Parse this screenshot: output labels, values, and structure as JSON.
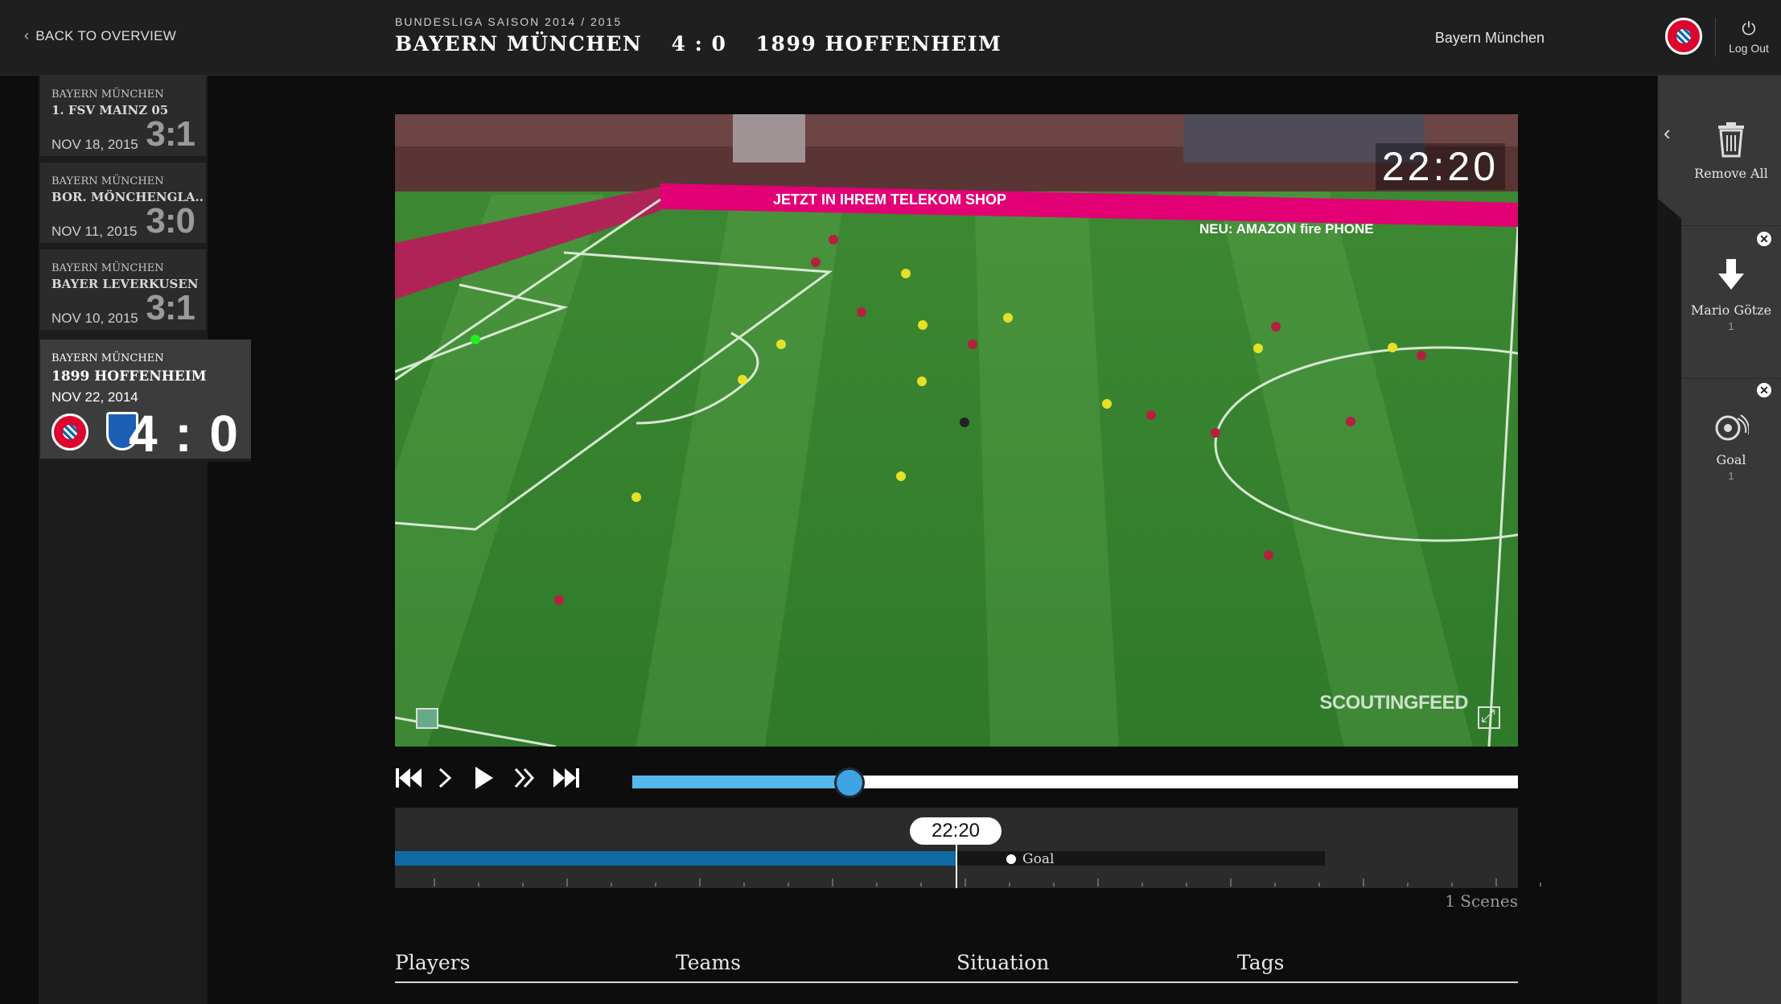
{
  "header": {
    "back_label": "BACK TO OVERVIEW",
    "season": "BUNDESLIGA SAISON 2014 / 2015",
    "home_team": "BAYERN MÜNCHEN",
    "score": "4 : 0",
    "away_team": "1899 HOFFENHEIM",
    "user_team": "Bayern München",
    "logout_label": "Log Out"
  },
  "matches": [
    {
      "home": "BAYERN MÜNCHEN",
      "away": "1. FSV MAINZ 05",
      "date": "NOV 18, 2015",
      "score": "3:1"
    },
    {
      "home": "BAYERN MÜNCHEN",
      "away": "BOR. MÖNCHENGLA..",
      "date": "NOV 11, 2015",
      "score": "3:0"
    },
    {
      "home": "BAYERN MÜNCHEN",
      "away": "BAYER LEVERKUSEN",
      "date": "NOV 10, 2015",
      "score": "3:1"
    },
    {
      "home": "BAYERN MÜNCHEN",
      "away": "1899 HOFFENHEIM",
      "date": "NOV 22, 2014",
      "score": "4 : 0",
      "active": true
    }
  ],
  "video": {
    "clock": "22:20",
    "watermark": "SCOUTINGFEED",
    "banner_text": "JETZT IN IHREM TELEKOM SHOP",
    "banner_text2": "NEU: AMAZON fire PHONE"
  },
  "player": {
    "progress": 0.245
  },
  "timeline": {
    "current_time": "22:20",
    "progress": 0.5,
    "events": [
      {
        "label": "Goal"
      }
    ],
    "scene_count": "1 Scenes"
  },
  "tabs": [
    "Players",
    "Teams",
    "Situation",
    "Tags"
  ],
  "right_panel": {
    "remove_all": "Remove All",
    "filters": [
      {
        "label": "Mario Götze",
        "count": "1",
        "icon": "player-arrow-icon"
      },
      {
        "label": "Goal",
        "count": "1",
        "icon": "goal-ball-icon"
      }
    ]
  },
  "colors": {
    "accent": "#3fa4e4",
    "progress_fill": "#55b8ea",
    "timeline_fill": "#0f6aa6",
    "bayern_red": "#dc052d",
    "hoffenheim_blue": "#1a5fb4"
  }
}
